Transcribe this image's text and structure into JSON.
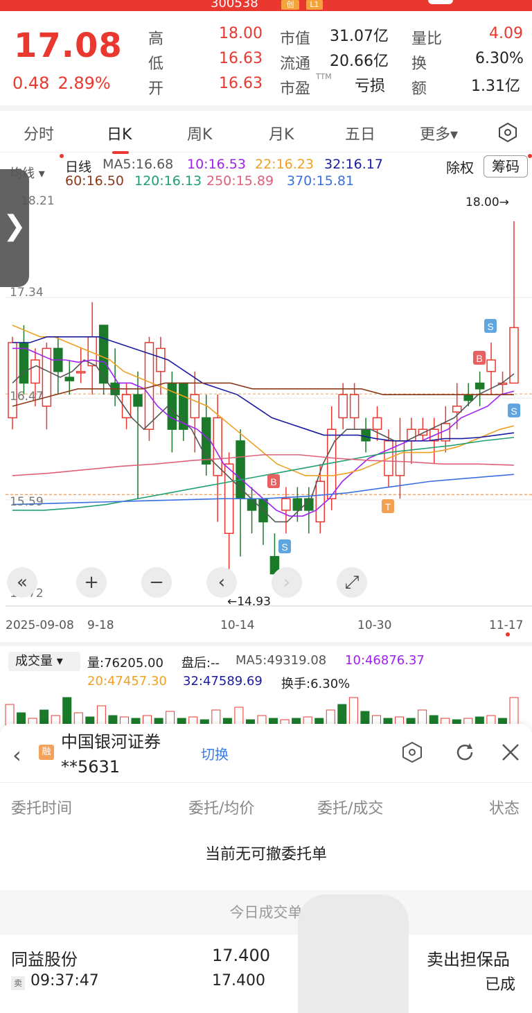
{
  "header": {
    "code": "300538",
    "badge1": "创",
    "badge2": "L1",
    "price": "17.08",
    "change": "0.48",
    "change_pct": "2.89%",
    "quotes": [
      {
        "label": "高",
        "value": "18.00"
      },
      {
        "label": "低",
        "value": "16.63"
      },
      {
        "label": "开",
        "value": "16.63"
      },
      {
        "label": "市值",
        "value": "31.07亿"
      },
      {
        "label": "流通",
        "value": "20.66亿"
      },
      {
        "label": "市盈",
        "value": "亏损"
      },
      {
        "label": "量比",
        "value": "4.09"
      },
      {
        "label": "换",
        "value": "6.30%"
      },
      {
        "label": "额",
        "value": "1.31亿"
      }
    ],
    "pe_tm": "TTM"
  },
  "tabs": [
    "分时",
    "日K",
    "周K",
    "月K",
    "五日",
    "更多▾"
  ],
  "active_tab": "日K",
  "chart_controls": {
    "avg_label": "均线 ▾",
    "series_label": "日线",
    "adjust_label": "除权",
    "chips_label": "筹码"
  },
  "ma_legend": [
    {
      "text": "MA5:16.68",
      "color": "#555555"
    },
    {
      "text": "10:16.53",
      "color": "#a020f0"
    },
    {
      "text": "22:16.23",
      "color": "#f0a020"
    },
    {
      "text": "32:16.17",
      "color": "#1a1aa0"
    },
    {
      "text": "60:16.50",
      "color": "#8b3a1a"
    },
    {
      "text": "120:16.13",
      "color": "#20a070"
    },
    {
      "text": "250:15.89",
      "color": "#e0607a"
    },
    {
      "text": "370:15.81",
      "color": "#3a6fe0"
    }
  ],
  "price_ticks": [
    "18.21",
    "17.34",
    "16.47",
    "15.59",
    "14.72"
  ],
  "date_ticks": [
    "2025-09-08",
    "9-18",
    "10-14",
    "10-30",
    "11-17"
  ],
  "annotations": {
    "high": "18.00→",
    "low": "←14.93"
  },
  "trade_marks": {
    "buy": "B",
    "sell": "S",
    "t": "T"
  },
  "volume": {
    "selector": "成交量 ▾",
    "vol": "量:76205.00",
    "after": "盘后:--",
    "ma5": "MA5:49319.08",
    "ma10": "10:46876.37",
    "ma20": "20:47457.30",
    "ma32": "32:47589.69",
    "turnover": "换手:6.30%"
  },
  "chart_data": {
    "type": "candlestick",
    "x_range": [
      "2025-09-08",
      "2025-11-17"
    ],
    "ylim": [
      14.72,
      18.21
    ],
    "high": 18.0,
    "low": 14.93,
    "last_close": 17.08
  },
  "sheet": {
    "broker": "中国银河证券",
    "account": "**5631",
    "badge": "融",
    "switch": "切换",
    "columns": [
      "委托时间",
      "委托/均价",
      "委托/成交",
      "状态"
    ],
    "empty_text": "当前无可撤委托单",
    "today_title": "今日成交单",
    "trade": {
      "name": "同益股份",
      "side_badge": "卖",
      "time": "09:37:47",
      "price1": "17.400",
      "price2": "17.400",
      "type": "卖出担保品",
      "status": "已成"
    }
  },
  "colors": {
    "up": "#e8382f",
    "down": "#1a7a2a",
    "accent": "#e8382f"
  }
}
